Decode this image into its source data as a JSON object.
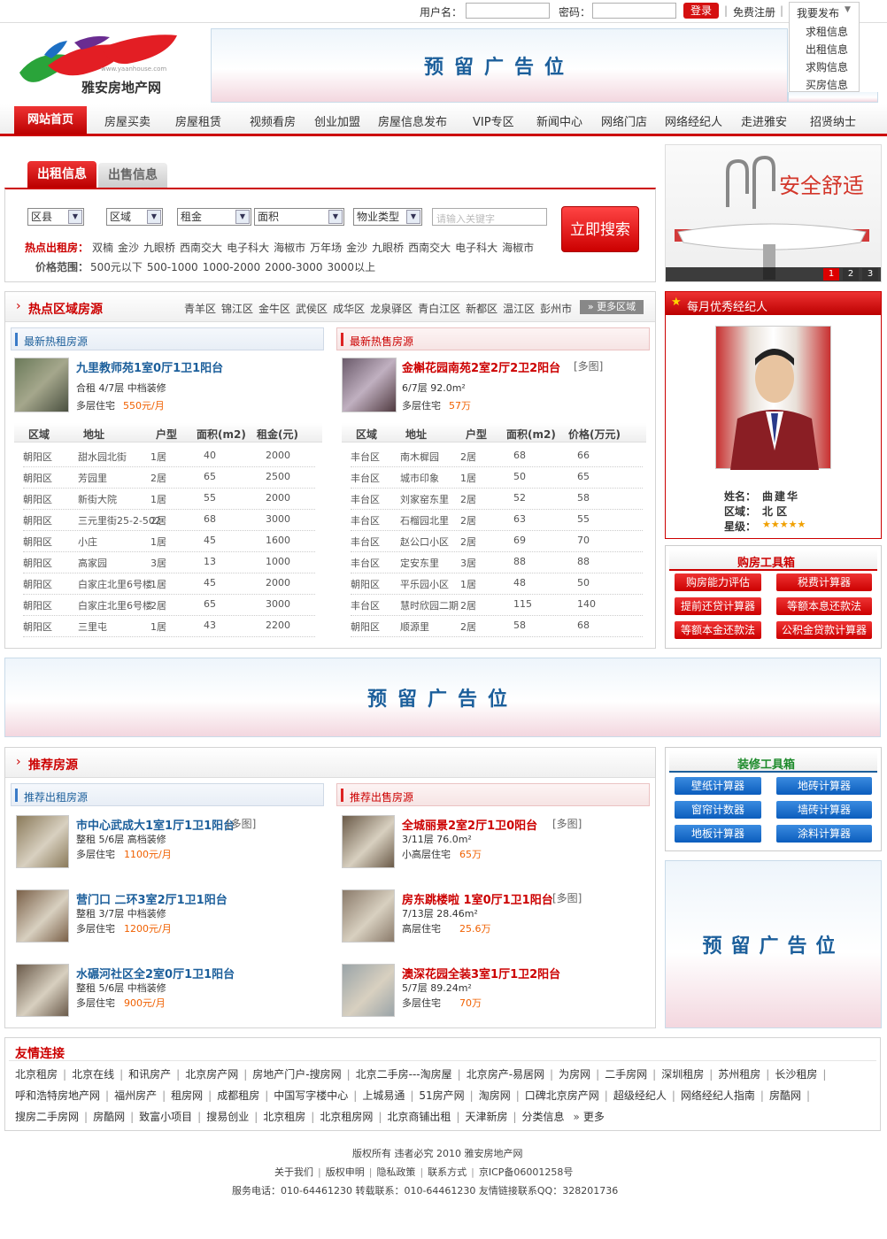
{
  "topbar": {
    "username_label": "用户名：",
    "password_label": "密码：",
    "login": "登录",
    "register": "免费注册",
    "publish": "我要发布",
    "publish_items": [
      "求租信息",
      "出租信息",
      "求购信息",
      "买房信息"
    ]
  },
  "logo": {
    "name": "雅安房地产网",
    "url_text": "www.yaanhouse.com"
  },
  "ad_text": "预留广告位",
  "nav": [
    "网站首页",
    "房屋买卖",
    "房屋租赁",
    "视频看房",
    "创业加盟",
    "房屋信息发布",
    "VIP专区",
    "新闻中心",
    "网络门店",
    "网络经纪人",
    "走进雅安",
    "招贤纳士"
  ],
  "search": {
    "tab_rent": "出租信息",
    "tab_sale": "出售信息",
    "selects": [
      "区县",
      "区域",
      "租金",
      "面积",
      "物业类型"
    ],
    "keyword_placeholder": "请输入关键字",
    "button": "立即搜索",
    "hot_label": "热点出租房：",
    "hot_items": [
      "双楠",
      "金沙",
      "九眼桥",
      "西南交大",
      "电子科大",
      "海椒市",
      "万年场",
      "金沙",
      "九眼桥",
      "西南交大",
      "电子科大",
      "海椒市"
    ],
    "price_label": "价格范围：",
    "price_items": [
      "500元以下",
      "500-1000",
      "1000-2000",
      "2000-3000",
      "3000以上"
    ]
  },
  "banner": {
    "text": "安全舒适",
    "pages": [
      "1",
      "2",
      "3"
    ]
  },
  "hot_area": {
    "title": "热点区域房源",
    "areas": [
      "青羊区",
      "锦江区",
      "金牛区",
      "武侯区",
      "成华区",
      "龙泉驿区",
      "青白江区",
      "新都区",
      "温江区",
      "彭州市"
    ],
    "more": "更多区域"
  },
  "hot_rent": {
    "title": "最新热租房源",
    "item_title": "九里教师苑1室0厅1卫1阳台",
    "line1": "合租 4/7层 中档装修",
    "line2": "多层住宅",
    "price": "550元/月",
    "headers": [
      "区域",
      "地址",
      "户型",
      "面积(m2)",
      "租金(元)"
    ],
    "rows": [
      [
        "朝阳区",
        "甜水园北街",
        "1居",
        "40",
        "2000"
      ],
      [
        "朝阳区",
        "芳园里",
        "2居",
        "65",
        "2500"
      ],
      [
        "朝阳区",
        "新街大院",
        "1居",
        "55",
        "2000"
      ],
      [
        "朝阳区",
        "三元里街25-2-502",
        "2居",
        "68",
        "3000"
      ],
      [
        "朝阳区",
        "小庄",
        "1居",
        "45",
        "1600"
      ],
      [
        "朝阳区",
        "高家园",
        "3居",
        "13",
        "1000"
      ],
      [
        "朝阳区",
        "白家庄北里6号楼",
        "1居",
        "45",
        "2000"
      ],
      [
        "朝阳区",
        "白家庄北里6号楼",
        "2居",
        "65",
        "3000"
      ],
      [
        "朝阳区",
        "三里屯",
        "1居",
        "43",
        "2200"
      ]
    ]
  },
  "hot_sale": {
    "title": "最新热售房源",
    "item_title": "金槲花园南苑2室2厅2卫2阳台",
    "tag": "[多图]",
    "line1": "6/7层 92.0m²",
    "line2": "多层住宅",
    "price": "57万",
    "headers": [
      "区域",
      "地址",
      "户型",
      "面积(m2)",
      "价格(万元)"
    ],
    "rows": [
      [
        "丰台区",
        "南木樨园",
        "2居",
        "68",
        "66"
      ],
      [
        "丰台区",
        "城市印象",
        "1居",
        "50",
        "65"
      ],
      [
        "丰台区",
        "刘家窑东里",
        "2居",
        "52",
        "58"
      ],
      [
        "丰台区",
        "石榴园北里",
        "2居",
        "63",
        "55"
      ],
      [
        "丰台区",
        "赵公口小区",
        "2居",
        "69",
        "70"
      ],
      [
        "丰台区",
        "定安东里",
        "3居",
        "88",
        "88"
      ],
      [
        "朝阳区",
        "平乐园小区",
        "1居",
        "48",
        "50"
      ],
      [
        "丰台区",
        "慧时欣园二期",
        "2居",
        "115",
        "140"
      ],
      [
        "朝阳区",
        "顺源里",
        "2居",
        "58",
        "68"
      ]
    ]
  },
  "agent": {
    "title": "每月优秀经纪人",
    "name_label": "姓名：",
    "name": "曲建华",
    "area_label": "区域：",
    "area": "北 区",
    "star_label": "星级：",
    "stars": "★★★★★"
  },
  "buy_tools": {
    "title": "购房工具箱",
    "buttons": [
      "购房能力评估",
      "税费计算器",
      "提前还贷计算器",
      "等额本息还款法",
      "等额本金还款法",
      "公积金贷款计算器"
    ]
  },
  "deco_tools": {
    "title": "装修工具箱",
    "buttons": [
      "壁纸计算器",
      "地砖计算器",
      "窗帘计数器",
      "墙砖计算器",
      "地板计算器",
      "涂料计算器"
    ]
  },
  "recommend": {
    "title": "推荐房源",
    "rent_title": "推荐出租房源",
    "sale_title": "推荐出售房源",
    "rent_items": [
      {
        "title": "市中心武成大1室1厅1卫1阳台",
        "tag": "[多图]",
        "line1": "整租 5/6层 高档装修",
        "line2": "多层住宅",
        "price": "1100元/月"
      },
      {
        "title": "营门口 二环3室2厅1卫1阳台",
        "tag": "",
        "line1": "整租 3/7层 中档装修",
        "line2": "多层住宅",
        "price": "1200元/月"
      },
      {
        "title": "水碾河社区全2室0厅1卫1阳台",
        "tag": "",
        "line1": "整租 5/6层 中档装修",
        "line2": "多层住宅",
        "price": "900元/月"
      }
    ],
    "sale_items": [
      {
        "title": "全城丽景2室2厅1卫0阳台",
        "tag": "[多图]",
        "line1": "3/11层 76.0m²",
        "line2": "小高层住宅",
        "price": "65万"
      },
      {
        "title": "房东跳楼啦 1室0厅1卫1阳台",
        "tag": "[多图]",
        "line1": "7/13层 28.46m²",
        "line2": "高层住宅",
        "price": "25.6万"
      },
      {
        "title": "澳深花园全装3室1厅1卫2阳台",
        "tag": "",
        "line1": "5/7层 89.24m²",
        "line2": "多层住宅",
        "price": "70万"
      }
    ]
  },
  "friends": {
    "title": "友情连接",
    "row1": [
      "北京租房",
      "北京在线",
      "和讯房产",
      "北京房产网",
      "房地产门户-搜房网",
      "北京二手房---淘房屋",
      "北京房产-易居网",
      "为房网",
      "二手房网",
      "深圳租房",
      "苏州租房",
      "长沙租房"
    ],
    "row2": [
      "呼和浩特房地产网",
      "福州房产",
      "租房网",
      "成都租房",
      "中国写字楼中心",
      "上城易通",
      "51房产网",
      "淘房网",
      "口碑北京房产网",
      "超级经纪人",
      "网络经纪人指南",
      "房酷网"
    ],
    "row3": [
      "搜房二手房网",
      "房酷网",
      "致富小项目",
      "搜易创业",
      "北京租房",
      "北京租房网",
      "北京商铺出租",
      "天津新房",
      "分类信息"
    ],
    "more": "更多"
  },
  "footer": {
    "line1": "版权所有 违者必究 2010 雅安房地产网",
    "links": [
      "关于我们",
      "版权申明",
      "隐私政策",
      "联系方式",
      "京ICP备06001258号"
    ],
    "line3": "服务电话：010-64461230 转载联系：010-64461230 友情链接联系QQ：328201736"
  },
  "colors": {
    "accent": "#c00000",
    "link_blue": "#1c5f9b",
    "price_orange": "#f06000"
  }
}
